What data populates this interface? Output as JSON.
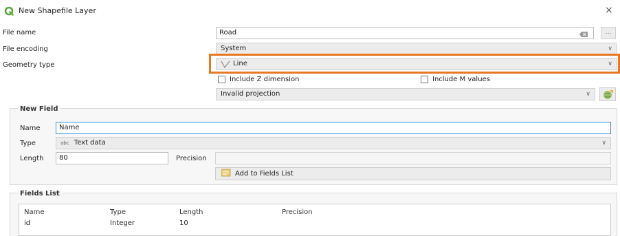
{
  "window": {
    "title": "New Shapefile Layer",
    "close_glyph": "×",
    "logo_icon": "qgis-logo-icon"
  },
  "form": {
    "file_name_label": "File name",
    "file_name_value": "Road",
    "browse_label": "...",
    "file_encoding_label": "File encoding",
    "file_encoding_value": "System",
    "geometry_type_label": "Geometry type",
    "geometry_type_value": "Line",
    "include_z_label": "Include Z dimension",
    "include_m_label": "Include M values",
    "projection_value": "Invalid projection"
  },
  "new_field": {
    "title": "New Field",
    "name_label": "Name",
    "name_value": "Name",
    "type_label": "Type",
    "type_prefix": "abc",
    "type_value": "Text data",
    "length_label": "Length",
    "length_value": "80",
    "precision_label": "Precision",
    "precision_value": "",
    "add_button_label": "Add to Fields List"
  },
  "fields_list": {
    "title": "Fields List",
    "columns": [
      "Name",
      "Type",
      "Length",
      "Precision"
    ],
    "rows": [
      [
        "id",
        "Integer",
        "10",
        ""
      ]
    ]
  },
  "colors": {
    "highlight": "#e87722",
    "focus_border": "#3a8fd6"
  }
}
